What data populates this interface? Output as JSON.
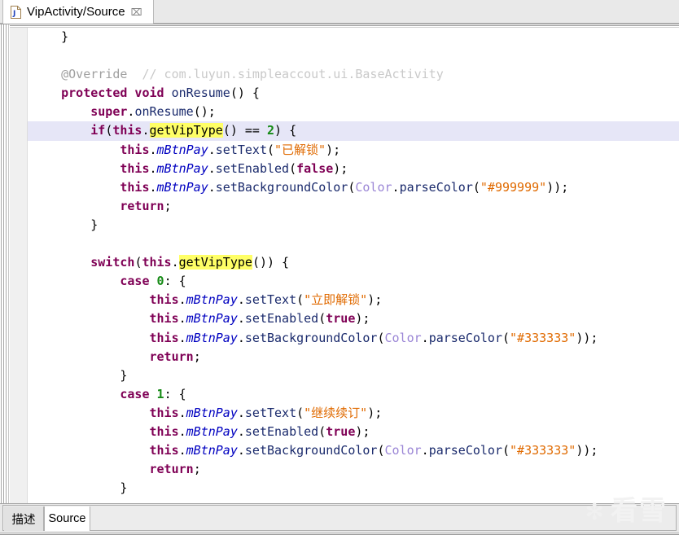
{
  "window": {
    "title": "VipActivity/Source"
  },
  "tabbar": {
    "active_tab": {
      "label": "VipActivity/Source",
      "icon": "java-file-icon",
      "close_label": "⌧"
    }
  },
  "bottom_tabs": {
    "items": [
      {
        "label": "描述",
        "active": false
      },
      {
        "label": "Source",
        "active": true
      }
    ]
  },
  "watermark": {
    "text": "看雪",
    "logo": "✻"
  },
  "colors": {
    "keyword": "#7f0055",
    "comment": "#c9c9c9",
    "method": "#1a2a6c",
    "field": "#0000c0",
    "string": "#e06a00",
    "number": "#158a15",
    "class": "#9b86d6",
    "search_highlight": "#ffff66",
    "current_line": "#e6e6f7",
    "gutter": "#f0f0f0",
    "tab_inactive_bg": "#e9e9e9",
    "editor_bg": "#ffffff"
  },
  "editor": {
    "language": "java",
    "highlighted_token": "getVipType",
    "current_line_number": 5,
    "lines": [
      {
        "indent": 1,
        "current": false,
        "tokens": [
          {
            "t": "pl",
            "v": "}"
          }
        ]
      },
      {
        "indent": 0,
        "current": false,
        "tokens": []
      },
      {
        "indent": 1,
        "current": false,
        "tokens": [
          {
            "t": "anno",
            "v": "@Override"
          },
          {
            "t": "pl",
            "v": "  "
          },
          {
            "t": "cmt",
            "v": "// com.luyun.simpleaccout.ui.BaseActivity"
          }
        ]
      },
      {
        "indent": 1,
        "current": false,
        "tokens": [
          {
            "t": "kw",
            "v": "protected void"
          },
          {
            "t": "pl",
            "v": " "
          },
          {
            "t": "mth",
            "v": "onResume"
          },
          {
            "t": "pl",
            "v": "() {"
          }
        ]
      },
      {
        "indent": 2,
        "current": false,
        "tokens": [
          {
            "t": "kw",
            "v": "super"
          },
          {
            "t": "pl",
            "v": "."
          },
          {
            "t": "mth",
            "v": "onResume"
          },
          {
            "t": "pl",
            "v": "();"
          }
        ]
      },
      {
        "indent": 2,
        "current": true,
        "tokens": [
          {
            "t": "kw",
            "v": "if"
          },
          {
            "t": "pl",
            "v": "("
          },
          {
            "t": "kw",
            "v": "this"
          },
          {
            "t": "pl",
            "v": "."
          },
          {
            "t": "hl",
            "v": "getVipType"
          },
          {
            "t": "pl",
            "v": "() == "
          },
          {
            "t": "num",
            "v": "2"
          },
          {
            "t": "pl",
            "v": ") {"
          }
        ]
      },
      {
        "indent": 3,
        "current": false,
        "tokens": [
          {
            "t": "kw",
            "v": "this"
          },
          {
            "t": "pl",
            "v": "."
          },
          {
            "t": "fld",
            "v": "mBtnPay"
          },
          {
            "t": "pl",
            "v": "."
          },
          {
            "t": "mth",
            "v": "setText"
          },
          {
            "t": "pl",
            "v": "("
          },
          {
            "t": "str",
            "v": "\"已解锁\""
          },
          {
            "t": "pl",
            "v": ");"
          }
        ]
      },
      {
        "indent": 3,
        "current": false,
        "tokens": [
          {
            "t": "kw",
            "v": "this"
          },
          {
            "t": "pl",
            "v": "."
          },
          {
            "t": "fld",
            "v": "mBtnPay"
          },
          {
            "t": "pl",
            "v": "."
          },
          {
            "t": "mth",
            "v": "setEnabled"
          },
          {
            "t": "pl",
            "v": "("
          },
          {
            "t": "kw",
            "v": "false"
          },
          {
            "t": "pl",
            "v": ");"
          }
        ]
      },
      {
        "indent": 3,
        "current": false,
        "tokens": [
          {
            "t": "kw",
            "v": "this"
          },
          {
            "t": "pl",
            "v": "."
          },
          {
            "t": "fld",
            "v": "mBtnPay"
          },
          {
            "t": "pl",
            "v": "."
          },
          {
            "t": "mth",
            "v": "setBackgroundColor"
          },
          {
            "t": "pl",
            "v": "("
          },
          {
            "t": "cls",
            "v": "Color"
          },
          {
            "t": "pl",
            "v": "."
          },
          {
            "t": "mth",
            "v": "parseColor"
          },
          {
            "t": "pl",
            "v": "("
          },
          {
            "t": "str",
            "v": "\"#999999\""
          },
          {
            "t": "pl",
            "v": "));"
          }
        ]
      },
      {
        "indent": 3,
        "current": false,
        "tokens": [
          {
            "t": "kw",
            "v": "return"
          },
          {
            "t": "pl",
            "v": ";"
          }
        ]
      },
      {
        "indent": 2,
        "current": false,
        "tokens": [
          {
            "t": "pl",
            "v": "}"
          }
        ]
      },
      {
        "indent": 0,
        "current": false,
        "tokens": []
      },
      {
        "indent": 2,
        "current": false,
        "tokens": [
          {
            "t": "kw",
            "v": "switch"
          },
          {
            "t": "pl",
            "v": "("
          },
          {
            "t": "kw",
            "v": "this"
          },
          {
            "t": "pl",
            "v": "."
          },
          {
            "t": "hl",
            "v": "getVipType"
          },
          {
            "t": "pl",
            "v": "()) {"
          }
        ]
      },
      {
        "indent": 3,
        "current": false,
        "tokens": [
          {
            "t": "kw",
            "v": "case"
          },
          {
            "t": "pl",
            "v": " "
          },
          {
            "t": "num",
            "v": "0"
          },
          {
            "t": "pl",
            "v": ": {"
          }
        ]
      },
      {
        "indent": 4,
        "current": false,
        "tokens": [
          {
            "t": "kw",
            "v": "this"
          },
          {
            "t": "pl",
            "v": "."
          },
          {
            "t": "fld",
            "v": "mBtnPay"
          },
          {
            "t": "pl",
            "v": "."
          },
          {
            "t": "mth",
            "v": "setText"
          },
          {
            "t": "pl",
            "v": "("
          },
          {
            "t": "str",
            "v": "\"立即解锁\""
          },
          {
            "t": "pl",
            "v": ");"
          }
        ]
      },
      {
        "indent": 4,
        "current": false,
        "tokens": [
          {
            "t": "kw",
            "v": "this"
          },
          {
            "t": "pl",
            "v": "."
          },
          {
            "t": "fld",
            "v": "mBtnPay"
          },
          {
            "t": "pl",
            "v": "."
          },
          {
            "t": "mth",
            "v": "setEnabled"
          },
          {
            "t": "pl",
            "v": "("
          },
          {
            "t": "kw",
            "v": "true"
          },
          {
            "t": "pl",
            "v": ");"
          }
        ]
      },
      {
        "indent": 4,
        "current": false,
        "tokens": [
          {
            "t": "kw",
            "v": "this"
          },
          {
            "t": "pl",
            "v": "."
          },
          {
            "t": "fld",
            "v": "mBtnPay"
          },
          {
            "t": "pl",
            "v": "."
          },
          {
            "t": "mth",
            "v": "setBackgroundColor"
          },
          {
            "t": "pl",
            "v": "("
          },
          {
            "t": "cls",
            "v": "Color"
          },
          {
            "t": "pl",
            "v": "."
          },
          {
            "t": "mth",
            "v": "parseColor"
          },
          {
            "t": "pl",
            "v": "("
          },
          {
            "t": "str",
            "v": "\"#333333\""
          },
          {
            "t": "pl",
            "v": "));"
          }
        ]
      },
      {
        "indent": 4,
        "current": false,
        "tokens": [
          {
            "t": "kw",
            "v": "return"
          },
          {
            "t": "pl",
            "v": ";"
          }
        ]
      },
      {
        "indent": 3,
        "current": false,
        "tokens": [
          {
            "t": "pl",
            "v": "}"
          }
        ]
      },
      {
        "indent": 3,
        "current": false,
        "tokens": [
          {
            "t": "kw",
            "v": "case"
          },
          {
            "t": "pl",
            "v": " "
          },
          {
            "t": "num",
            "v": "1"
          },
          {
            "t": "pl",
            "v": ": {"
          }
        ]
      },
      {
        "indent": 4,
        "current": false,
        "tokens": [
          {
            "t": "kw",
            "v": "this"
          },
          {
            "t": "pl",
            "v": "."
          },
          {
            "t": "fld",
            "v": "mBtnPay"
          },
          {
            "t": "pl",
            "v": "."
          },
          {
            "t": "mth",
            "v": "setText"
          },
          {
            "t": "pl",
            "v": "("
          },
          {
            "t": "str",
            "v": "\"继续续订\""
          },
          {
            "t": "pl",
            "v": ");"
          }
        ]
      },
      {
        "indent": 4,
        "current": false,
        "tokens": [
          {
            "t": "kw",
            "v": "this"
          },
          {
            "t": "pl",
            "v": "."
          },
          {
            "t": "fld",
            "v": "mBtnPay"
          },
          {
            "t": "pl",
            "v": "."
          },
          {
            "t": "mth",
            "v": "setEnabled"
          },
          {
            "t": "pl",
            "v": "("
          },
          {
            "t": "kw",
            "v": "true"
          },
          {
            "t": "pl",
            "v": ");"
          }
        ]
      },
      {
        "indent": 4,
        "current": false,
        "tokens": [
          {
            "t": "kw",
            "v": "this"
          },
          {
            "t": "pl",
            "v": "."
          },
          {
            "t": "fld",
            "v": "mBtnPay"
          },
          {
            "t": "pl",
            "v": "."
          },
          {
            "t": "mth",
            "v": "setBackgroundColor"
          },
          {
            "t": "pl",
            "v": "("
          },
          {
            "t": "cls",
            "v": "Color"
          },
          {
            "t": "pl",
            "v": "."
          },
          {
            "t": "mth",
            "v": "parseColor"
          },
          {
            "t": "pl",
            "v": "("
          },
          {
            "t": "str",
            "v": "\"#333333\""
          },
          {
            "t": "pl",
            "v": "));"
          }
        ]
      },
      {
        "indent": 4,
        "current": false,
        "tokens": [
          {
            "t": "kw",
            "v": "return"
          },
          {
            "t": "pl",
            "v": ";"
          }
        ]
      },
      {
        "indent": 3,
        "current": false,
        "tokens": [
          {
            "t": "pl",
            "v": "}"
          }
        ]
      }
    ]
  }
}
